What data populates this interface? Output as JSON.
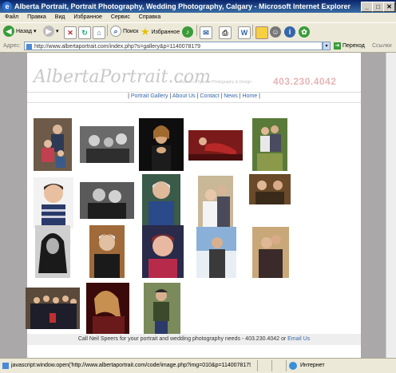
{
  "window": {
    "title": "Alberta Portrait, Portrait Photography, Wedding Photography, Calgary - Microsoft Internet Explorer"
  },
  "menu": [
    "Файл",
    "Правка",
    "Вид",
    "Избранное",
    "Сервис",
    "Справка"
  ],
  "toolbar": {
    "back_label": "Назад",
    "search_label": "Поиск",
    "favorites_label": "Избранное"
  },
  "address": {
    "label": "Адрес:",
    "url": "http://www.albertaportrait.com/index.php?s=gallery&p=1140078179",
    "go_label": "Переход",
    "links_label": "Ссылки"
  },
  "site": {
    "logo": "AlbertaPortrait.com",
    "tagline": "a division of Speers Photography & Design",
    "phone": "403.230.4042",
    "nav": [
      "Portrait Gallery",
      "About Us",
      "Contact",
      "News",
      "Home"
    ],
    "footer_text": "Call Neil Speers for your portrait and wedding photography needs - 403.230.4042 or ",
    "footer_link": "Email Us"
  },
  "status": {
    "text": "javascript:window.open('http://www.albertaportrait.com/code/image.php?img=010&p=1140078179','','statu",
    "zone": "Интернет"
  },
  "colors": {
    "accent": "#3366aa",
    "phone": "#e8b4b4"
  }
}
